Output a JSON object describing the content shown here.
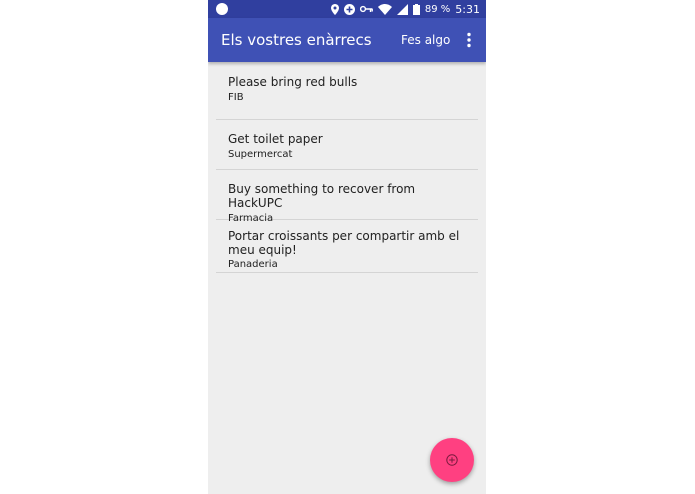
{
  "status_bar": {
    "battery_percent": "89 %",
    "time": "5:31",
    "icons": [
      "circle-icon",
      "location-icon",
      "add-circle-icon",
      "key-icon",
      "wifi-icon",
      "signal-icon",
      "battery-icon"
    ]
  },
  "app_bar": {
    "title": "Els vostres enàrrecs",
    "action_label": "Fes algo",
    "overflow_icon": "more-vert-icon"
  },
  "tasks": [
    {
      "title": "Please bring red bulls",
      "place": "FIB"
    },
    {
      "title": "Get toilet paper",
      "place": "Supermercat"
    },
    {
      "title": "Buy something to recover from HackUPC",
      "place": "Farmacia"
    },
    {
      "title": "Portar croissants per compartir amb el meu equip!",
      "place": "Panaderia"
    }
  ],
  "fab": {
    "icon": "add-circle-icon"
  },
  "colors": {
    "status_bar": "#303f9f",
    "app_bar": "#3f51b5",
    "fab": "#ff4081",
    "background": "#eeeeee"
  }
}
